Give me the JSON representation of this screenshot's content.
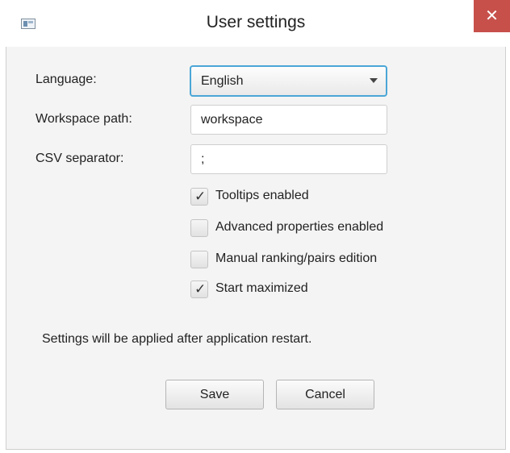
{
  "window": {
    "title": "User settings",
    "close_glyph": "✕",
    "app_icon": "app-window-icon",
    "close_color": "#c7504b"
  },
  "form": {
    "language_label": "Language:",
    "language_value": "English",
    "workspace_label": "Workspace path:",
    "workspace_value": "workspace",
    "csv_label": "CSV separator:",
    "csv_value": ";"
  },
  "options": [
    {
      "label": "Tooltips enabled",
      "checked": true
    },
    {
      "label": "Advanced properties enabled",
      "checked": false
    },
    {
      "label": "Manual ranking/pairs edition",
      "checked": false
    },
    {
      "label": "Start maximized",
      "checked": true
    }
  ],
  "checkmark_glyph": "✓",
  "info_text": "Settings will be applied after application restart.",
  "buttons": {
    "save": "Save",
    "cancel": "Cancel"
  },
  "colors": {
    "focus_border": "#4aa6d6"
  }
}
